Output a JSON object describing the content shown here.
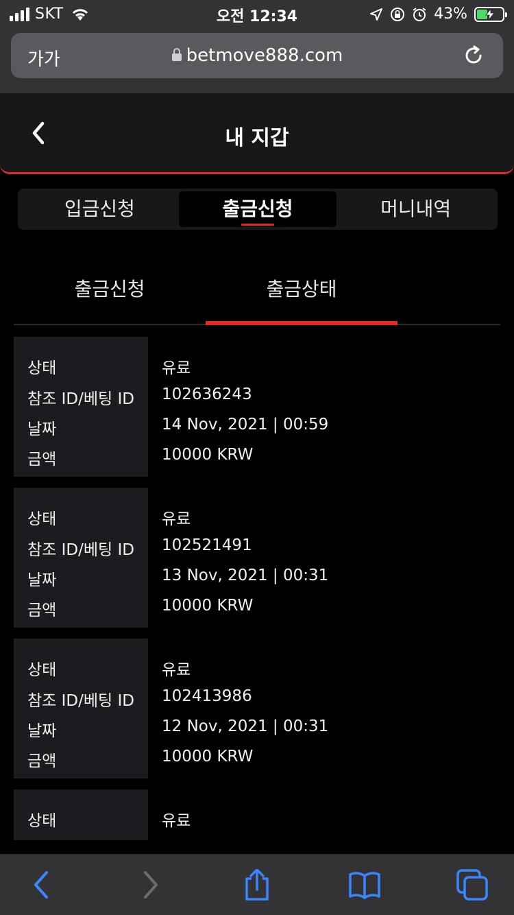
{
  "status_bar": {
    "carrier": "SKT",
    "time": "오전 12:34",
    "battery_percent": "43%",
    "battery_level": 0.43
  },
  "browser": {
    "text_size_label": "가가",
    "url": "betmove888.com"
  },
  "header": {
    "title": "내 지갑"
  },
  "top_tabs": [
    {
      "label": "입금신청",
      "active": false
    },
    {
      "label": "출금신청",
      "active": true
    },
    {
      "label": "머니내역",
      "active": false
    }
  ],
  "sub_tabs": [
    {
      "label": "출금신청",
      "active": false
    },
    {
      "label": "출금상태",
      "active": true
    }
  ],
  "labels": {
    "status": "상태",
    "ref_id": "참조 ID/베팅 ID",
    "date": "날짜",
    "amount": "금액"
  },
  "records": [
    {
      "status": "유료",
      "ref_id": "102636243",
      "date": "14 Nov, 2021 | 00:59",
      "amount": "10000 KRW"
    },
    {
      "status": "유료",
      "ref_id": "102521491",
      "date": "13 Nov, 2021 | 00:31",
      "amount": "10000 KRW"
    },
    {
      "status": "유료",
      "ref_id": "102413986",
      "date": "12 Nov, 2021 | 00:31",
      "amount": "10000 KRW"
    },
    {
      "status": "유료"
    }
  ],
  "colors": {
    "accent": "#e52a25",
    "browser_chrome": "#333335",
    "header_bg": "#18181b",
    "label_bg": "#1c1c20",
    "toolbar_icon": "#3a86ff"
  },
  "toolbar_icons": [
    "back-arrow-icon",
    "forward-arrow-icon",
    "share-icon",
    "bookmarks-icon",
    "tabs-icon"
  ]
}
